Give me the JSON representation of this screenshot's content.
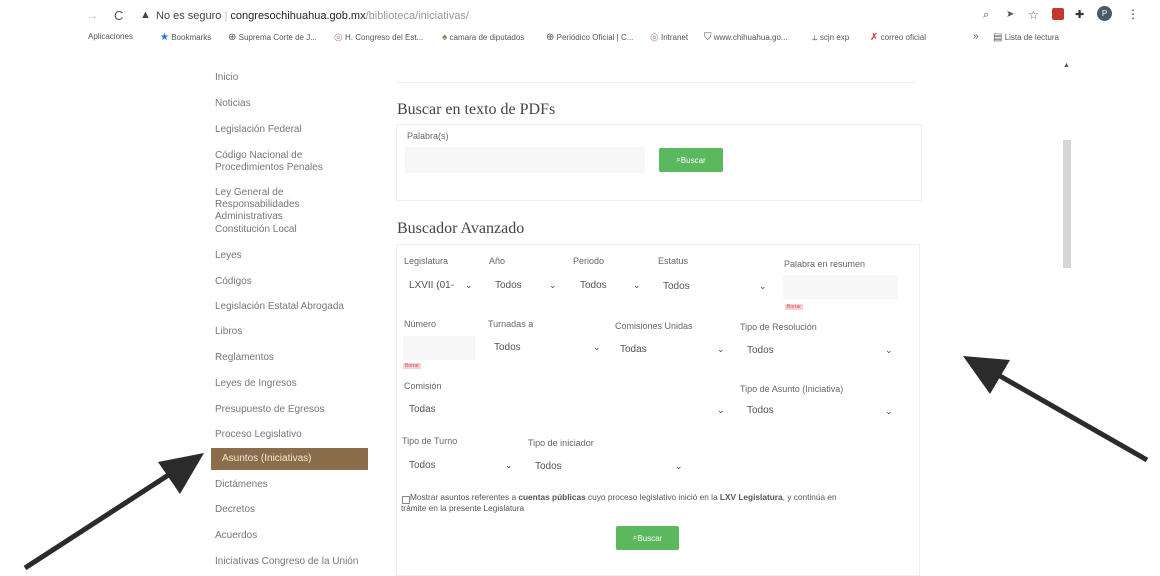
{
  "browser": {
    "security": "No es seguro",
    "domain": "congresochihuahua.gob.mx",
    "path": "/biblioteca/iniciativas/",
    "avatar_letter": "P"
  },
  "bookmarks": [
    {
      "icon": "apps-icon",
      "label": "Aplicaciones"
    },
    {
      "icon": "star-icon",
      "label": "Bookmarks"
    },
    {
      "icon": "globe-icon",
      "label": "Suprema Corte de J..."
    },
    {
      "icon": "seal-icon",
      "label": "H. Congreso del Est..."
    },
    {
      "icon": "crest-icon",
      "label": "camara de diputados"
    },
    {
      "icon": "globe-icon",
      "label": "Periódico Oficial | C..."
    },
    {
      "icon": "seal-icon",
      "label": "Intranet"
    },
    {
      "icon": "shield-icon",
      "label": "www.chihuahua.go..."
    },
    {
      "icon": "scjn-icon",
      "label": "scjn exp"
    },
    {
      "icon": "x-icon",
      "label": "correo oficial"
    }
  ],
  "reading_list": "Lista de lectura",
  "more_bookmarks": "»",
  "sidebar": [
    "Inicio",
    "Noticias",
    "Legislación Federal",
    "Código Nacional de Procedimientos Penales",
    "Ley General de Responsabilidades Administrativas",
    "Constitución Local",
    "Leyes",
    "Códigos",
    "Legislación Estatal Abrogada",
    "Libros",
    "Reglamentos",
    "Leyes de Ingresos",
    "Presupuesto de Egresos",
    "Proceso Legislativo",
    "Asuntos (Iniciativas)",
    "Dictámenes",
    "Decretos",
    "Acuerdos",
    "Iniciativas Congreso de la Unión"
  ],
  "pdf_search": {
    "title": "Buscar en texto de PDFs",
    "label": "Palabra(s)",
    "button": "Buscar"
  },
  "advanced": {
    "title": "Buscador Avanzado",
    "legislatura_label": "Legislatura",
    "legislatura_value": "LXVII (01-",
    "anio_label": "Año",
    "anio_value": "Todos",
    "periodo_label": "Periodo",
    "periodo_value": "Todos",
    "estatus_label": "Estatus",
    "estatus_value": "Todos",
    "palabra_label": "Palabra en resumen",
    "borrar": "Borrar",
    "numero_label": "Número",
    "turnadas_label": "Turnadas a",
    "turnadas_value": "Todos",
    "comisiones_label": "Comisiones Unidas",
    "comisiones_value": "Todas",
    "resolucion_label": "Tipo de Resolución",
    "resolucion_value": "Todos",
    "comision_label": "Comisión",
    "comision_value": "Todas",
    "asunto_label": "Tipo de Asunto (Iniciativa)",
    "asunto_value": "Todos",
    "turno_label": "Tipo de Turno",
    "turno_value": "Todos",
    "iniciador_label": "Tipo de iniciador",
    "iniciador_value": "Todos",
    "check_text_1": "Mostrar asuntos referentes a ",
    "check_bold_1": "cuentas públicas",
    "check_text_2": " cuyo proceso legislativo inició en la ",
    "check_bold_2": "LXV Legislatura",
    "check_text_3": ", y continúa en",
    "check_text_4": "trámite en la presente Legislatura",
    "button": "Buscar"
  },
  "colors": {
    "active": "#8a6d4b",
    "button": "#5cb85c"
  }
}
